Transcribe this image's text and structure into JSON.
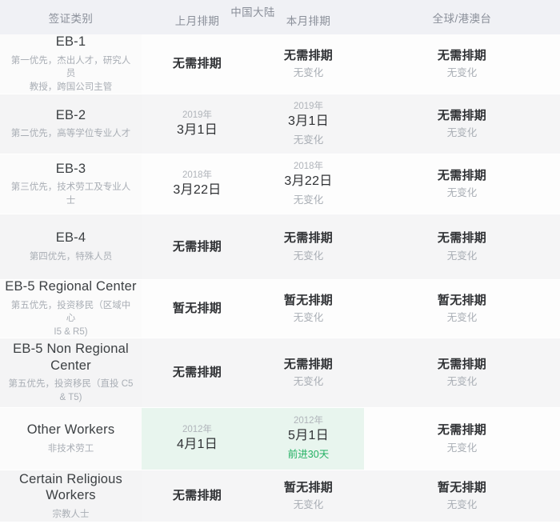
{
  "header": {
    "category_label": "签证类别",
    "group_label": "中国大陆",
    "prev_month_label": "上月排期",
    "current_month_label": "本月排期",
    "global_label": "全球/港澳台"
  },
  "colors": {
    "header_bg": "#f0f1f5",
    "row_bg": "#fdfdfd",
    "row_alt_bg": "#f5f5f6",
    "highlight_bg": "#e8f5ee",
    "advance_text": "#22b062",
    "primary_text": "#2f3134",
    "muted_text": "#a9aeb5"
  },
  "rows": [
    {
      "name": "EB-1",
      "desc": "第一优先，杰出人才，研究人员\n教授，跨国公司主管",
      "prev": {
        "year": "",
        "value": "无需排期",
        "note": ""
      },
      "current": {
        "year": "",
        "value": "无需排期",
        "note": "无变化"
      },
      "global": {
        "year": "",
        "value": "无需排期",
        "note": "无变化"
      },
      "highlight": false
    },
    {
      "name": "EB-2",
      "desc": "第二优先，高等学位专业人才",
      "prev": {
        "year": "2019年",
        "value": "3月1日",
        "note": ""
      },
      "current": {
        "year": "2019年",
        "value": "3月1日",
        "note": "无变化"
      },
      "global": {
        "year": "",
        "value": "无需排期",
        "note": "无变化"
      },
      "highlight": false
    },
    {
      "name": "EB-3",
      "desc": "第三优先，技术劳工及专业人士",
      "prev": {
        "year": "2018年",
        "value": "3月22日",
        "note": ""
      },
      "current": {
        "year": "2018年",
        "value": "3月22日",
        "note": "无变化"
      },
      "global": {
        "year": "",
        "value": "无需排期",
        "note": "无变化"
      },
      "highlight": false
    },
    {
      "name": "EB-4",
      "desc": "第四优先，特殊人员",
      "prev": {
        "year": "",
        "value": "无需排期",
        "note": ""
      },
      "current": {
        "year": "",
        "value": "无需排期",
        "note": "无变化"
      },
      "global": {
        "year": "",
        "value": "无需排期",
        "note": "无变化"
      },
      "highlight": false
    },
    {
      "name": "EB-5 Regional Center",
      "desc": "第五优先，投资移民（区域中心\nI5 & R5)",
      "prev": {
        "year": "",
        "value": "暂无排期",
        "note": ""
      },
      "current": {
        "year": "",
        "value": "暂无排期",
        "note": "无变化"
      },
      "global": {
        "year": "",
        "value": "暂无排期",
        "note": "无变化"
      },
      "highlight": false
    },
    {
      "name": "EB-5 Non Regional Center",
      "desc": "第五优先，投资移民（直投 C5\n& T5)",
      "prev": {
        "year": "",
        "value": "无需排期",
        "note": ""
      },
      "current": {
        "year": "",
        "value": "无需排期",
        "note": "无变化"
      },
      "global": {
        "year": "",
        "value": "无需排期",
        "note": "无变化"
      },
      "highlight": false
    },
    {
      "name": "Other Workers",
      "desc": "非技术劳工",
      "prev": {
        "year": "2012年",
        "value": "4月1日",
        "note": ""
      },
      "current": {
        "year": "2012年",
        "value": "5月1日",
        "note": "前进30天"
      },
      "global": {
        "year": "",
        "value": "无需排期",
        "note": "无变化"
      },
      "highlight": true
    },
    {
      "name": "Certain Religious Workers",
      "desc": "宗教人士",
      "prev": {
        "year": "",
        "value": "无需排期",
        "note": ""
      },
      "current": {
        "year": "",
        "value": "暂无排期",
        "note": "无变化"
      },
      "global": {
        "year": "",
        "value": "暂无排期",
        "note": "无变化"
      },
      "highlight": false
    }
  ]
}
